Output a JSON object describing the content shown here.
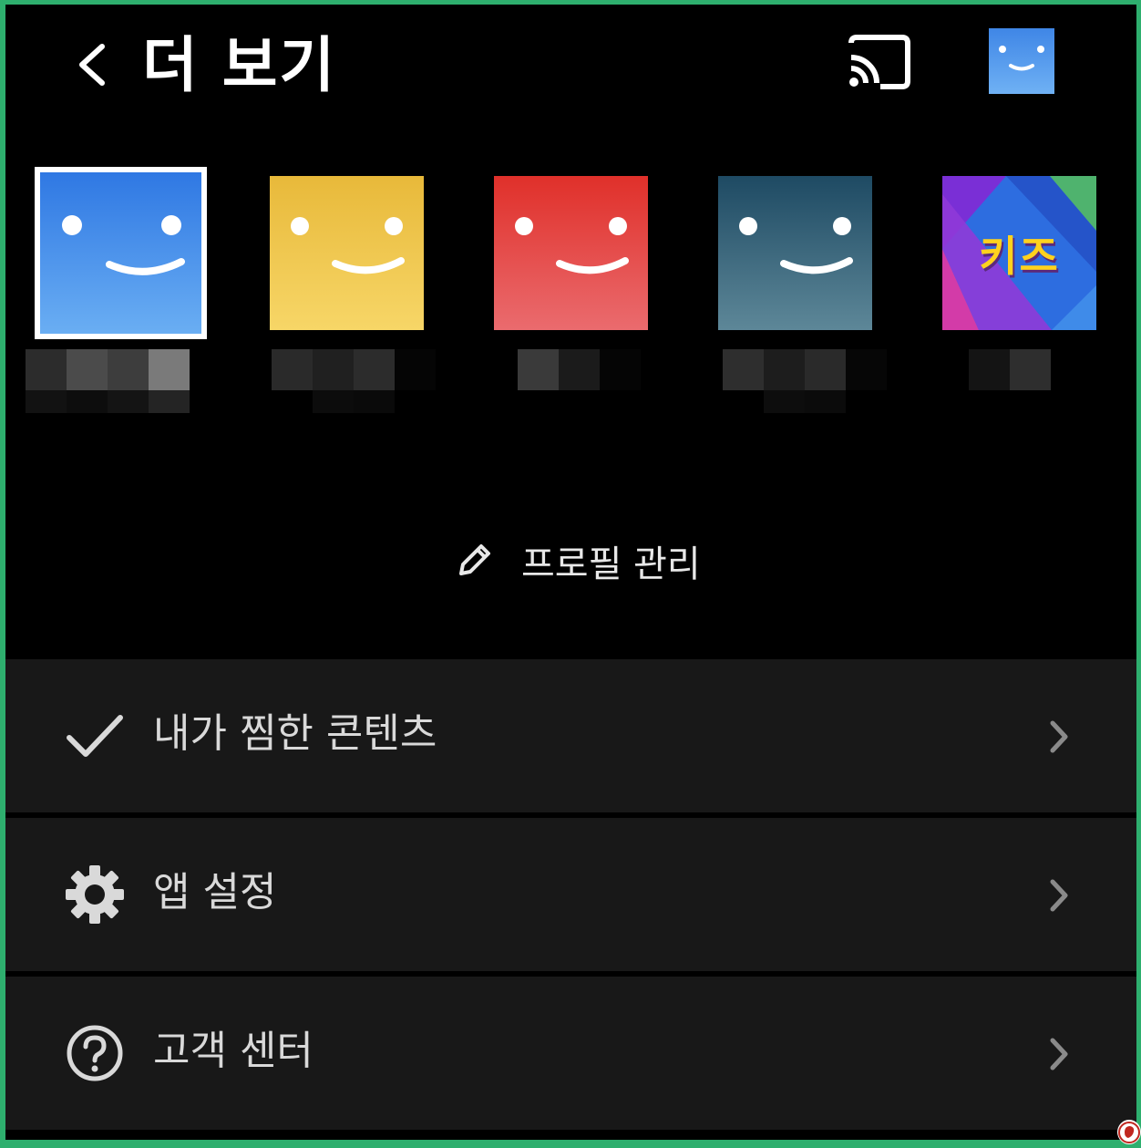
{
  "header": {
    "title": "더 보기",
    "back_icon": "chevron-left-icon",
    "cast_icon": "cast-icon",
    "avatar_icon": "smiley-avatar"
  },
  "profiles": [
    {
      "color_top": "#2f78e3",
      "color_bottom": "#6aaef3",
      "selected": true,
      "kind": "smiley"
    },
    {
      "color_top": "#e8b93a",
      "color_bottom": "#f7d667",
      "selected": false,
      "kind": "smiley"
    },
    {
      "color_top": "#e0302a",
      "color_bottom": "#ea6b6e",
      "selected": false,
      "kind": "smiley"
    },
    {
      "color_top": "#1e4a63",
      "color_bottom": "#5d8798",
      "selected": false,
      "kind": "smiley"
    },
    {
      "label": "키즈",
      "selected": false,
      "kind": "kids"
    }
  ],
  "manage": {
    "label": "프로필 관리",
    "icon": "pencil-icon"
  },
  "menu": [
    {
      "label": "내가 찜한 콘텐츠",
      "icon": "check-icon"
    },
    {
      "label": "앱 설정",
      "icon": "gear-icon"
    },
    {
      "label": "고객 센터",
      "icon": "help-circle-icon"
    }
  ],
  "colors": {
    "frame_border": "#2eaf6e",
    "background": "#000000",
    "menu_row": "#181818",
    "text": "#d9d9d9"
  }
}
